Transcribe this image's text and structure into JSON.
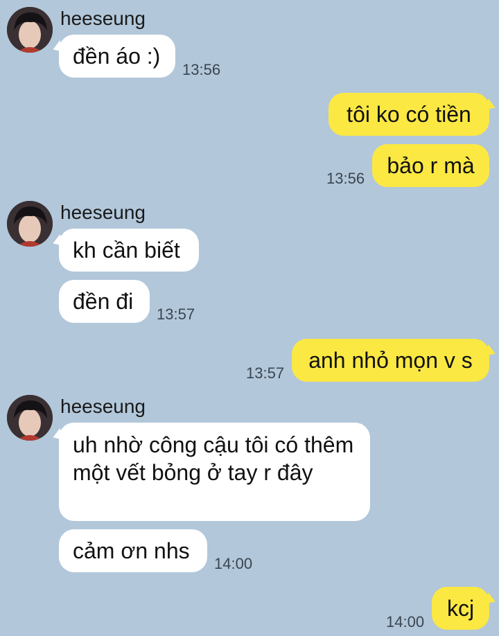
{
  "chat": {
    "messages": [
      {
        "sender": "heeseung",
        "text": "đền áo :)",
        "time": "13:56"
      },
      {
        "text": "tôi ko có tiền"
      },
      {
        "text": "bảo r mà",
        "time": "13:56"
      },
      {
        "sender": "heeseung",
        "text": "kh cần biết"
      },
      {
        "text": "đền đi",
        "time": "13:57"
      },
      {
        "text": "anh nhỏ mọn v s",
        "time": "13:57"
      },
      {
        "sender": "heeseung",
        "text": "uh nhờ công cậu tôi có thêm một vết bỏng ở tay r đây"
      },
      {
        "text": "cảm ơn nhs",
        "time": "14:00"
      },
      {
        "text": "kcj",
        "time": "14:00"
      }
    ]
  },
  "colors": {
    "background": "#b2c7da",
    "incoming_bubble": "#ffffff",
    "outgoing_bubble": "#fbe843"
  }
}
